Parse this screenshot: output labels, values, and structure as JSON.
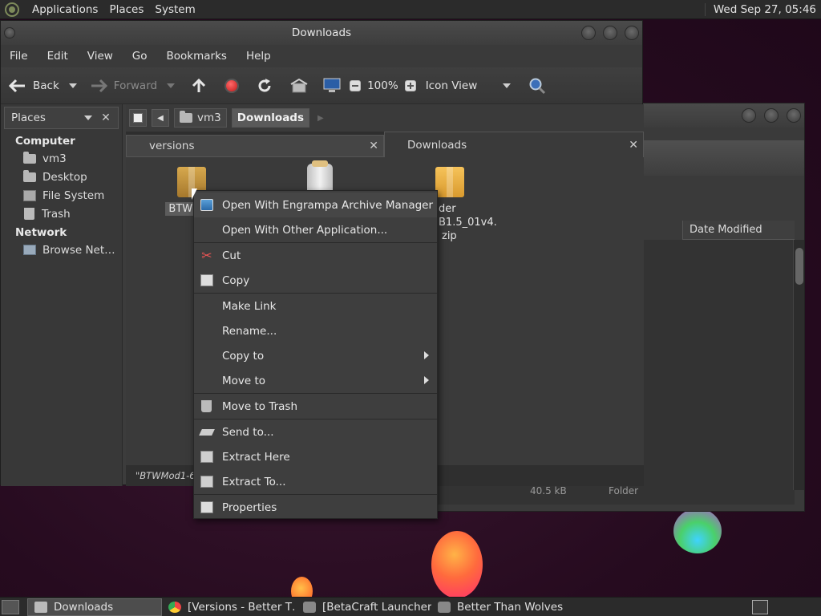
{
  "top_panel": {
    "menus": [
      "Applications",
      "Places",
      "System"
    ],
    "clock": "Wed Sep 27, 05:46"
  },
  "window": {
    "title": "Downloads",
    "menus": [
      "File",
      "Edit",
      "View",
      "Go",
      "Bookmarks",
      "Help"
    ]
  },
  "toolbar": {
    "back": "Back",
    "forward": "Forward",
    "zoom": "100%",
    "view_mode": "Icon View"
  },
  "sidebar": {
    "header": "Places",
    "sections": [
      {
        "title": "Computer",
        "items": [
          {
            "label": "vm3",
            "icon": "home-folder-icon"
          },
          {
            "label": "Desktop",
            "icon": "desktop-folder-icon"
          },
          {
            "label": "File System",
            "icon": "drive-icon"
          },
          {
            "label": "Trash",
            "icon": "trash-icon"
          }
        ]
      },
      {
        "title": "Network",
        "items": [
          {
            "label": "Browse Net…",
            "icon": "network-icon"
          }
        ]
      }
    ]
  },
  "location": {
    "crumbs": [
      "vm3",
      "Downloads"
    ]
  },
  "tabs": [
    {
      "label": "versions"
    },
    {
      "label": "Downloads"
    }
  ],
  "files": [
    {
      "label": "BTWMod",
      "icon": "package-icon"
    },
    {
      "label": "",
      "icon": "jar-icon"
    },
    {
      "label": "der B1.5_01v4.",
      "label2": "zip",
      "icon": "package-icon"
    }
  ],
  "status": "\"BTWMod1-60",
  "back_window": {
    "column_header": "Date Modified",
    "footer_size": "40.5 kB",
    "footer_type": "Folder"
  },
  "context_menu": {
    "items": [
      {
        "label": "Open With Engrampa Archive Manager",
        "icon": "engrampa-icon"
      },
      {
        "label": "Open With Other Application...",
        "icon": ""
      },
      {
        "label": "Cut",
        "icon": "scissors-icon"
      },
      {
        "label": "Copy",
        "icon": "copy-icon"
      },
      {
        "label": "Make Link",
        "icon": ""
      },
      {
        "label": "Rename...",
        "icon": ""
      },
      {
        "label": "Copy to",
        "icon": "",
        "submenu": true
      },
      {
        "label": "Move to",
        "icon": "",
        "submenu": true
      },
      {
        "label": "Move to Trash",
        "icon": "trash-icon"
      },
      {
        "label": "Send to...",
        "icon": "send-icon"
      },
      {
        "label": "Extract Here",
        "icon": "extract-icon"
      },
      {
        "label": "Extract To...",
        "icon": "extract-icon"
      },
      {
        "label": "Properties",
        "icon": "properties-icon"
      }
    ]
  },
  "taskbar": [
    {
      "label": "Downloads",
      "icon": "folder-icon",
      "active": true
    },
    {
      "label": "[Versions - Better T…",
      "icon": "chrome-icon"
    },
    {
      "label": "[BetaCraft Launcher…",
      "icon": "app-icon"
    },
    {
      "label": "Better Than Wolves …",
      "icon": "app-icon"
    }
  ]
}
